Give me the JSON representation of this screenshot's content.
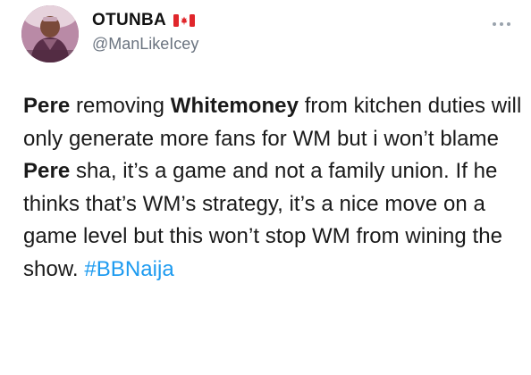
{
  "tweet": {
    "author": {
      "display_name": "OTUNBA",
      "handle": "@ManLikeIcey",
      "badge_icon": "canada-flag-icon",
      "avatar_icon": "profile-avatar"
    },
    "menu_icon": "more-options-icon",
    "body": {
      "segments": [
        {
          "text": "Pere",
          "bold": true
        },
        {
          "text": " removing ",
          "bold": false
        },
        {
          "text": "Whitemoney",
          "bold": true
        },
        {
          "text": " from kitchen duties will only generate more fans for WM but i won’t blame ",
          "bold": false
        },
        {
          "text": "Pere",
          "bold": true
        },
        {
          "text": " sha, it’s a game and not a family union. If he thinks that’s WM’s strategy, it’s a nice move on a game level but this won’t stop WM from wining the show. ",
          "bold": false
        }
      ],
      "hashtag": "#BBNaija"
    },
    "colors": {
      "hashtag": "#1d9bf0",
      "handle": "#6b7480",
      "text": "#1a1a1a"
    }
  }
}
